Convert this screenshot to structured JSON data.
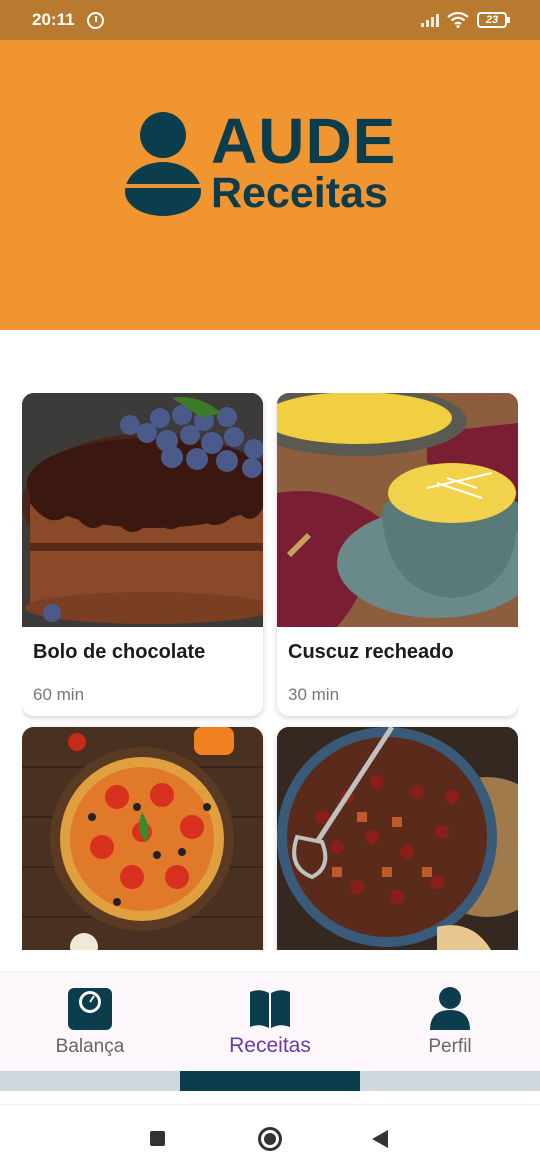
{
  "status_bar": {
    "time": "20:11",
    "battery": "23"
  },
  "app": {
    "logo_line1": "AUDE",
    "logo_line2": "Receitas",
    "brand_color": "#f0952f",
    "accent_color": "#0c3d4c"
  },
  "recipes": [
    {
      "title": "Bolo de chocolate",
      "time": "60 min",
      "image": "chocolate-cake"
    },
    {
      "title": "Cuscuz recheado",
      "time": "30 min",
      "image": "cuscuz"
    },
    {
      "title": "",
      "time": "",
      "image": "pizza"
    },
    {
      "title": "",
      "time": "",
      "image": "chili"
    }
  ],
  "bottom_nav": {
    "items": [
      {
        "label": "Balança",
        "icon": "scale-icon",
        "active": false
      },
      {
        "label": "Receitas",
        "icon": "book-icon",
        "active": true
      },
      {
        "label": "Perfil",
        "icon": "person-icon",
        "active": false
      }
    ]
  }
}
